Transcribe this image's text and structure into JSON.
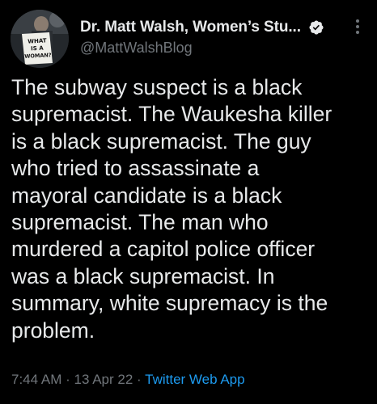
{
  "author": {
    "display_name": "Dr. Matt Walsh, Women’s Stu...",
    "handle": "@MattWalshBlog",
    "avatar_sign_text": [
      "WHAT",
      "IS A",
      "WOMAN?"
    ],
    "verified_icon": "verified-badge-icon"
  },
  "tweet": {
    "text_lines": [
      "The subway suspect is a black",
      "supremacist. The Waukesha killer",
      "is a black supremacist. The guy",
      "who tried to assassinate a",
      "mayoral candidate is a black",
      "supremacist. The man who",
      "murdered a capitol police officer",
      "was a black supremacist. In",
      "summary, white supremacy is the",
      "problem."
    ],
    "time": "7:44 AM",
    "separator": "·",
    "date": "13 Apr 22",
    "source": "Twitter Web App"
  },
  "colors": {
    "background": "#000000",
    "text": "#e7e9ea",
    "secondary": "#71767b",
    "accent": "#1d9bf0"
  }
}
